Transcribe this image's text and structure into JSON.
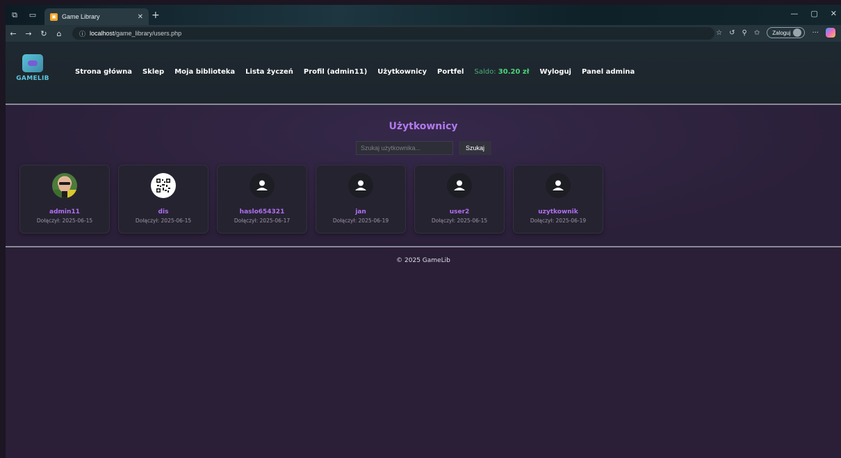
{
  "browser": {
    "tab_title": "Game Library",
    "url_host": "localhost",
    "url_path": "/game_library/users.php",
    "profile_label": "Zaloguj"
  },
  "header": {
    "logo_text": "GAMELIB",
    "nav": [
      {
        "label": "Strona główna"
      },
      {
        "label": "Sklep"
      },
      {
        "label": "Moja biblioteka"
      },
      {
        "label": "Lista życzeń"
      },
      {
        "label": "Profil (admin11)"
      },
      {
        "label": "Użytkownicy"
      },
      {
        "label": "Portfel"
      }
    ],
    "saldo_label": "Saldo:",
    "saldo_value": "30.20 zł",
    "logout_label": "Wyloguj",
    "admin_label": "Panel admina"
  },
  "main": {
    "title": "Użytkownicy",
    "search_placeholder": "Szukaj użytkownika...",
    "search_button": "Szukaj",
    "users": [
      {
        "name": "admin11",
        "joined": "Dołączył: 2025-06-15",
        "avatar": "photo"
      },
      {
        "name": "dis",
        "joined": "Dołączył: 2025-06-15",
        "avatar": "qr"
      },
      {
        "name": "haslo654321",
        "joined": "Dołączył: 2025-06-17",
        "avatar": "default"
      },
      {
        "name": "jan",
        "joined": "Dołączył: 2025-06-19",
        "avatar": "default"
      },
      {
        "name": "user2",
        "joined": "Dołączył: 2025-06-15",
        "avatar": "default"
      },
      {
        "name": "uzytkownik",
        "joined": "Dołączył: 2025-06-19",
        "avatar": "default"
      }
    ]
  },
  "footer": {
    "copyright": "© 2025 GameLib"
  },
  "colors": {
    "accent": "#b379f0",
    "saldo": "#4cd67a"
  }
}
